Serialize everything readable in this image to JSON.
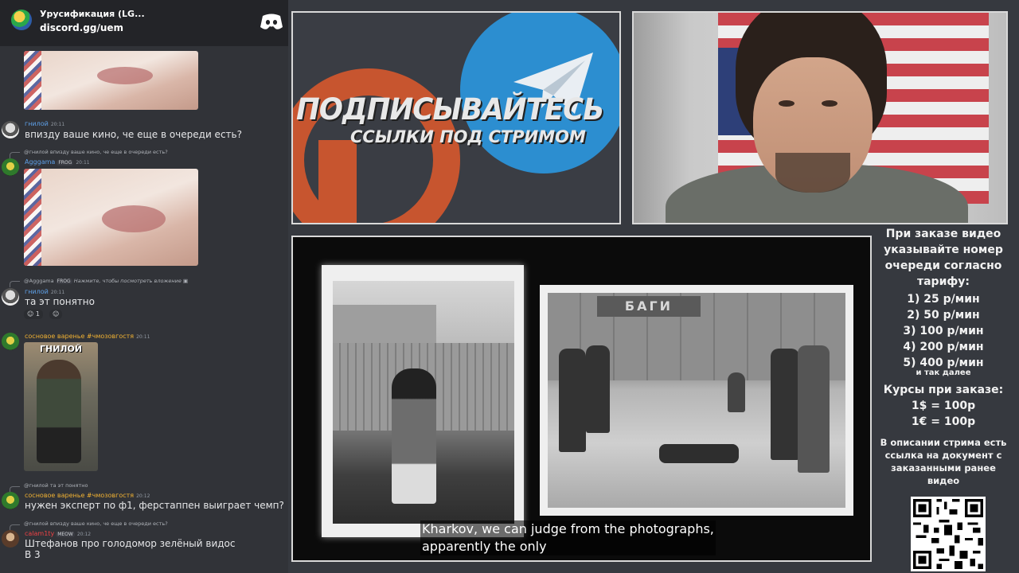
{
  "discord": {
    "server_name": "Урусификация (LG...",
    "invite": "discord.gg/uem"
  },
  "messages": [
    {
      "author": "гнилой",
      "time": "20:11",
      "text": "впизду ваше кино, че еще в очереди есть?"
    },
    {
      "reply_to": "@гнилой",
      "reply_text": "впизду ваше кино, че еще в очереди есть?",
      "author": "Agggama",
      "badge": "FROG",
      "time": "20:11"
    },
    {
      "reply_to": "@Agggama",
      "reply_badge": "FROG",
      "reply_text": "Нажмите, чтобы посмотреть вложение",
      "author": "гнилой",
      "time": "20:11",
      "text": "та эт понятно",
      "reaction_count": "1"
    },
    {
      "author": "сосновое варенье #чмозовгостя",
      "time": "20:11",
      "image_caption": "ГНИЛОЙ"
    },
    {
      "reply_to": "@гнилой",
      "reply_text": "та эт понятно",
      "author": "сосновое варенье #чмозовгостя",
      "time": "20:12",
      "text": "нужен эксперт по ф1, ферстаппен выиграет чемп?"
    },
    {
      "reply_to": "@гнилой",
      "reply_text": "впизду ваше кино, че еще в очереди есть?",
      "author": "calam1ty",
      "badge": "MEOW",
      "time": "20:12",
      "text": "Штефанов про голодомор зелёный видос",
      "text2": "В 3"
    }
  ],
  "promo": {
    "title": "ПОДПИСЫВАЙТЕСЬ",
    "subtitle": "ССЫЛКИ ПОД СТРИМОМ"
  },
  "video": {
    "sign": "БАГИ",
    "subtitle_line1": "Kharkov, we can judge from the photographs,",
    "subtitle_line2": "apparently the only"
  },
  "info": {
    "title": "При заказе видео указывайте номер очереди согласно тарифу:",
    "tariffs": [
      "1) 25 р/мин",
      "2) 50 р/мин",
      "3) 100 р/мин",
      "4) 200 р/мин",
      "5) 400 р/мин"
    ],
    "etc": "и так далее",
    "rates_title": "Курсы при заказе:",
    "rates": [
      "1$ = 100р",
      "1€ = 100р"
    ],
    "description": "В описании стрима есть ссылка на документ с заказанными ранее видео"
  },
  "colors": {
    "discord_bg": "#313338",
    "stream_bg": "#36393f",
    "telegram_blue": "#2c8ed0",
    "patreon_orange": "#c7552f"
  }
}
